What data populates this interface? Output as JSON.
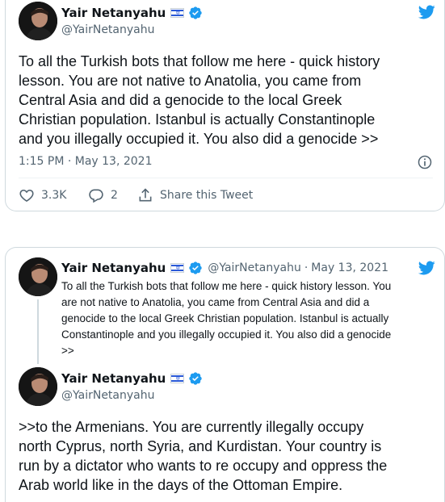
{
  "tweet1": {
    "display_name": "Yair Netanyahu",
    "handle": "@YairNetanyahu",
    "text_lines": [
      "To all the Turkish bots that follow me here - quick history",
      "lesson. You are not native to Anatolia, you came from",
      "Central Asia and did a genocide to the local Greek",
      "Christian population. Istanbul is actually Constantinople",
      "and you illegally occupied it. You also did a genocide >>"
    ],
    "timestamp": "1:15 PM · May 13, 2021",
    "likes": "3.3K",
    "replies": "2",
    "share_label": "Share this Tweet"
  },
  "tweet2": {
    "parent": {
      "display_name": "Yair Netanyahu",
      "handle": "@YairNetanyahu",
      "dot": "·",
      "date": "May 13, 2021",
      "text_lines": [
        "To all the Turkish bots that follow me here - quick history lesson. You",
        "are not native to Anatolia, you came from Central Asia and did a",
        "genocide to the local Greek Christian population. Istanbul is actually",
        "Constantinople and you illegally occupied it. You also did a genocide",
        ">>"
      ]
    },
    "reply": {
      "display_name": "Yair Netanyahu",
      "handle": "@YairNetanyahu",
      "text_lines": [
        ">>to the Armenians. You are currently illegally occupy",
        "north Cyprus, north Syria, and Kurdistan. Your country is",
        "run by a dictator who wants to re occupy and oppress the",
        "Arab world like in the days of the Ottoman Empire."
      ]
    }
  },
  "colors": {
    "twitter_blue": "#1d9bf0",
    "text": "#0f1419",
    "secondary": "#536471",
    "border": "#cfd9de"
  },
  "icons": [
    "twitter-bird-icon",
    "verified-badge-icon",
    "israel-flag-icon",
    "info-icon",
    "heart-icon",
    "reply-icon",
    "share-icon"
  ]
}
